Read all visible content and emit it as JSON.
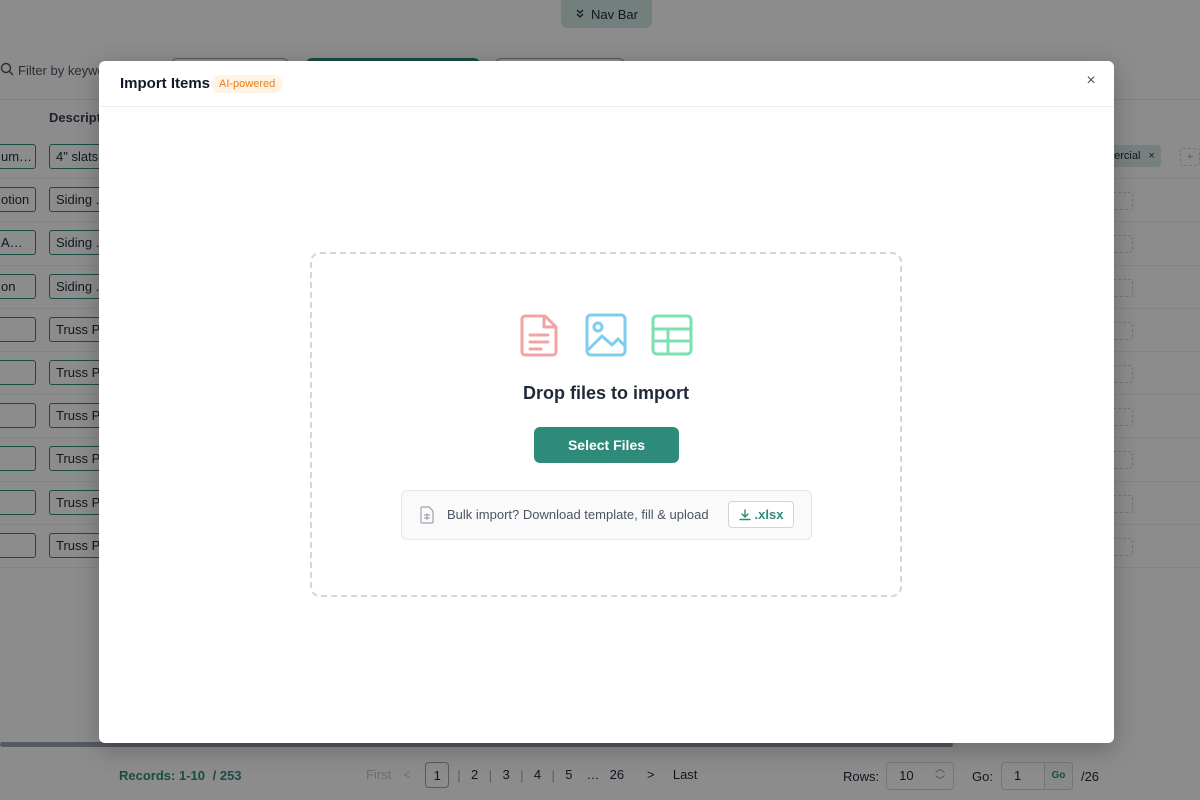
{
  "navbar_toggle": {
    "label": "Nav Bar"
  },
  "filter": {
    "placeholder": "Filter by keywo"
  },
  "table": {
    "column_header": "Descript",
    "rows": [
      {
        "c1": "um…",
        "c2": "4\" slats"
      },
      {
        "c1": "otion",
        "c2": "Siding ."
      },
      {
        "c1": "A…",
        "c2": "Siding ."
      },
      {
        "c1": "on",
        "c2": "Siding ."
      },
      {
        "c1": "",
        "c2": "Truss Pa"
      },
      {
        "c1": "",
        "c2": "Truss Pa"
      },
      {
        "c1": "",
        "c2": "Truss Pa"
      },
      {
        "c1": "",
        "c2": "Truss Pa"
      },
      {
        "c1": "",
        "c2": "Truss Pa"
      },
      {
        "c1": "",
        "c2": "Truss Pa"
      }
    ],
    "tag": {
      "label": "nercial",
      "remove": "×",
      "add": "+"
    }
  },
  "footer": {
    "records_label": "Records: 1-10",
    "records_total": "/ 253",
    "pager": {
      "first": "First",
      "prev": "<",
      "pages": [
        "1",
        "2",
        "3",
        "4",
        "5"
      ],
      "ellipsis": "…",
      "last_page": "26",
      "next": ">",
      "last": "Last"
    },
    "rows_label": "Rows:",
    "rows_value": "10",
    "go_label": "Go:",
    "go_value": "1",
    "go_button": "Go",
    "page_total": "/26"
  },
  "modal": {
    "title": "Import Items",
    "badge": "AI-powered",
    "close": "×",
    "drop_title": "Drop files to import",
    "select_button": "Select Files",
    "bulk_text": "Bulk import? Download template, fill & upload",
    "xlsx_button": ".xlsx",
    "icons": [
      "document-icon",
      "image-icon",
      "spreadsheet-icon"
    ]
  },
  "colors": {
    "accent": "#2e8b7a",
    "badge_text": "#f07c0e",
    "doc_icon": "#f4a3a3",
    "image_icon": "#7dcdf0",
    "sheet_icon": "#7ee0b0"
  }
}
